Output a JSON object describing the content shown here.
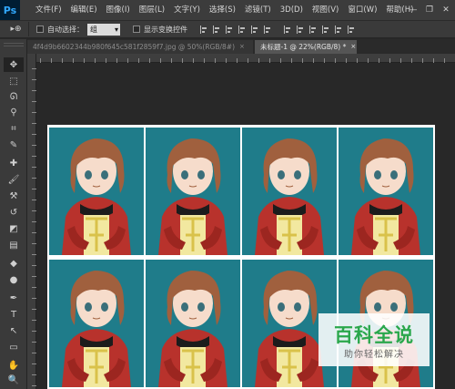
{
  "app": {
    "logo": "Ps"
  },
  "menu": [
    "文件(F)",
    "编辑(E)",
    "图像(I)",
    "图层(L)",
    "文字(Y)",
    "选择(S)",
    "滤镜(T)",
    "3D(D)",
    "视图(V)",
    "窗口(W)",
    "帮助(H)"
  ],
  "window_controls": {
    "minimize": "—",
    "restore": "❐",
    "close": "✕"
  },
  "options": {
    "tool_glyph": "▸⊕",
    "auto_select_label": "自动选择：",
    "auto_select_value": "组",
    "show_transform_label": "显示变换控件"
  },
  "tabs": [
    {
      "label": "4f4d9b6602344b980f645c581f2859f7.jpg @ 50%(RGB/8#)",
      "close": "×",
      "active": false
    },
    {
      "label": "未标题-1 @ 22%(RGB/8) *",
      "close": "×",
      "active": true
    }
  ],
  "tools": [
    {
      "name": "move-tool-icon",
      "glyph": "✥"
    },
    {
      "name": "marquee-tool-icon",
      "glyph": "⬚"
    },
    {
      "name": "lasso-tool-icon",
      "glyph": "ᘏ"
    },
    {
      "name": "quick-select-tool-icon",
      "glyph": "⚲"
    },
    {
      "name": "crop-tool-icon",
      "glyph": "⌗"
    },
    {
      "name": "eyedropper-tool-icon",
      "glyph": "✎"
    },
    {
      "name": "healing-brush-tool-icon",
      "glyph": "✚"
    },
    {
      "name": "brush-tool-icon",
      "glyph": "🖌"
    },
    {
      "name": "clone-stamp-tool-icon",
      "glyph": "⚒"
    },
    {
      "name": "history-brush-tool-icon",
      "glyph": "↺"
    },
    {
      "name": "eraser-tool-icon",
      "glyph": "◩"
    },
    {
      "name": "gradient-tool-icon",
      "glyph": "▤"
    },
    {
      "name": "blur-tool-icon",
      "glyph": "◆"
    },
    {
      "name": "dodge-tool-icon",
      "glyph": "●"
    },
    {
      "name": "pen-tool-icon",
      "glyph": "✒"
    },
    {
      "name": "type-tool-icon",
      "glyph": "T"
    },
    {
      "name": "path-select-tool-icon",
      "glyph": "↖"
    },
    {
      "name": "shape-tool-icon",
      "glyph": "▭"
    },
    {
      "name": "hand-tool-icon",
      "glyph": "✋"
    },
    {
      "name": "zoom-tool-icon",
      "glyph": "🔍"
    }
  ],
  "watermark": {
    "title": "百科全说",
    "subtitle": "助你轻松解决"
  },
  "colors": {
    "cell_background": "#1f7c8a",
    "hoodie": "#b8322c",
    "hair": "#a0603e",
    "shirt": "#f2e8a0",
    "skin": "#f6dccb"
  }
}
